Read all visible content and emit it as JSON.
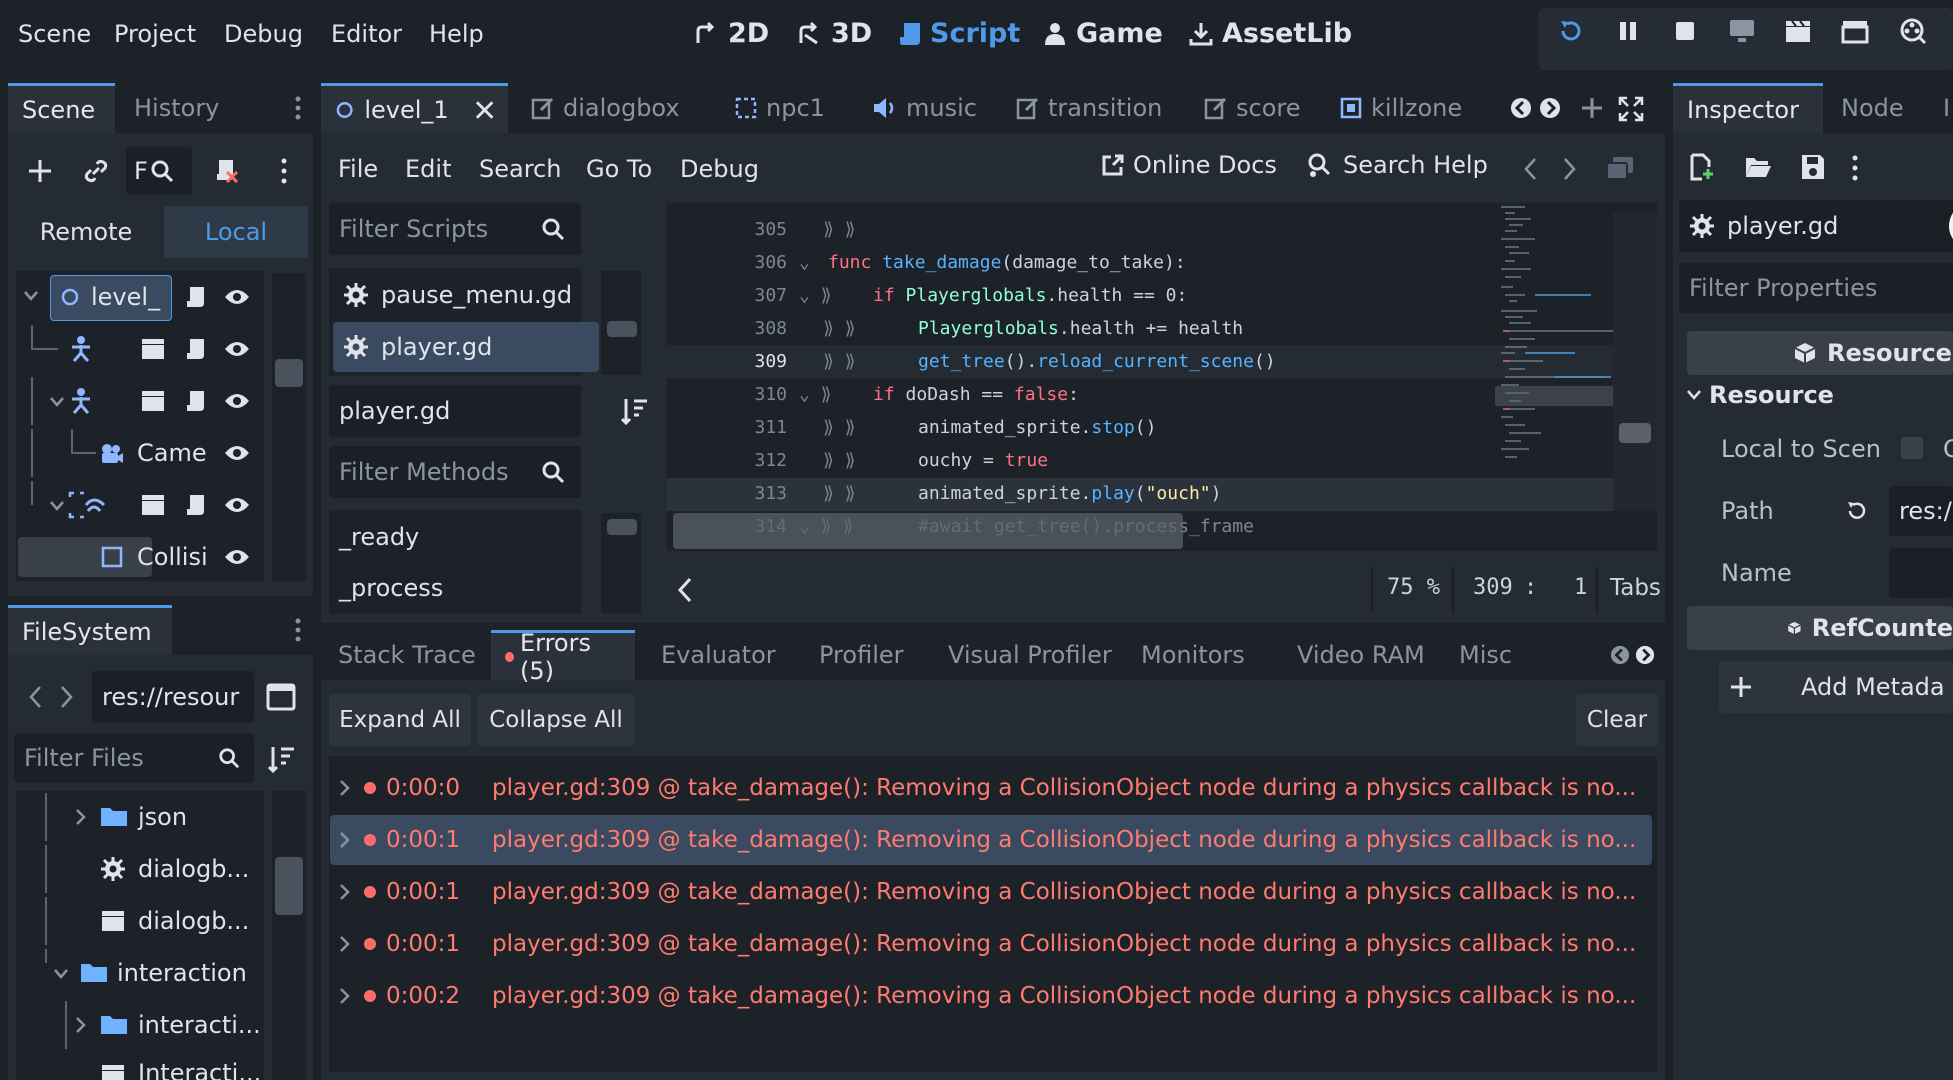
{
  "menu": [
    "Scene",
    "Project",
    "Debug",
    "Editor",
    "Help"
  ],
  "workspaces": [
    {
      "label": "2D",
      "icon": "2d-icon"
    },
    {
      "label": "3D",
      "icon": "3d-icon"
    },
    {
      "label": "Script",
      "icon": "script-icon"
    },
    {
      "label": "Game",
      "icon": "game-icon"
    },
    {
      "label": "AssetLib",
      "icon": "assetlib-icon"
    }
  ],
  "scene_dock": {
    "tabs": [
      "Scene",
      "History"
    ],
    "filter_abbrev": "F",
    "remote_label": "Remote",
    "local_label": "Local",
    "nodes": [
      "level_",
      "Came",
      "Collisi"
    ]
  },
  "filesystem": {
    "tab": "FileSystem",
    "path": "res://resour",
    "filter_placeholder": "Filter Files",
    "items": [
      "json",
      "dialogb...",
      "dialogb...",
      "interaction",
      "interacti...",
      "Interacti..."
    ]
  },
  "script_tabs": [
    "level_1",
    "dialogbox",
    "npc1",
    "music",
    "transition",
    "score",
    "killzone"
  ],
  "script_menu": [
    "File",
    "Edit",
    "Search",
    "Go To",
    "Debug"
  ],
  "online_docs": "Online Docs",
  "search_help": "Search Help",
  "scripts_panel": {
    "filter_placeholder": "Filter Scripts",
    "scripts": [
      "pause_menu.gd",
      "player.gd"
    ],
    "current": "player.gd",
    "methods_placeholder": "Filter Methods",
    "methods": [
      "_ready",
      "_process"
    ]
  },
  "code": {
    "line_numbers": [
      "305",
      "306",
      "307",
      "308",
      "309",
      "310",
      "311",
      "312",
      "313",
      "314"
    ],
    "l306": {
      "kw": "func",
      "name": "take_damage",
      "args": "(damage_to_take):"
    },
    "l307": {
      "kw": "if",
      "obj": "Playerglobals",
      "rest": ".health == 0:"
    },
    "l308": {
      "obj": "Playerglobals",
      "rest": ".health += health"
    },
    "l309": {
      "fn1": "get_tree",
      "mid": "().",
      "fn2": "reload_current_scene",
      "end": "()"
    },
    "l310": {
      "kw": "if",
      "rest": " doDash == ",
      "kw2": "false",
      "end": ":"
    },
    "l311": {
      "obj": "animated_sprite.",
      "fn": "stop",
      "end": "()"
    },
    "l312": {
      "obj": "ouchy = ",
      "kw": "true"
    },
    "l313": {
      "obj": "animated_sprite.",
      "fn": "play",
      "open": "(",
      "str": "\"ouch\"",
      "end": ")"
    },
    "l314": "#await get_tree().process_frame",
    "zoom": "75 %",
    "line": "309",
    "sep": ":",
    "col": "1",
    "indent": "Tabs"
  },
  "bottom_tabs": [
    "Stack Trace",
    "Errors (5)",
    "Evaluator",
    "Profiler",
    "Visual Profiler",
    "Monitors",
    "Video RAM",
    "Misc"
  ],
  "errors_panel": {
    "expand_all": "Expand All",
    "collapse_all": "Collapse All",
    "clear": "Clear",
    "rows": [
      {
        "time": "0:00:0",
        "msg": "player.gd:309 @ take_damage(): Removing a CollisionObject node during a physics callback is no..."
      },
      {
        "time": "0:00:1",
        "msg": "player.gd:309 @ take_damage(): Removing a CollisionObject node during a physics callback is no..."
      },
      {
        "time": "0:00:1",
        "msg": "player.gd:309 @ take_damage(): Removing a CollisionObject node during a physics callback is no..."
      },
      {
        "time": "0:00:1",
        "msg": "player.gd:309 @ take_damage(): Removing a CollisionObject node during a physics callback is no..."
      },
      {
        "time": "0:00:2",
        "msg": "player.gd:309 @ take_damage(): Removing a CollisionObject node during a physics callback is no..."
      }
    ]
  },
  "inspector": {
    "tabs": [
      "Inspector",
      "Node"
    ],
    "third_tab_fragment": "I",
    "object": "player.gd",
    "filter_placeholder": "Filter Properties",
    "resource_header": "Resource",
    "resource_section": "Resource",
    "local_to_scene": "Local to Scen",
    "local_value_fragment": "O",
    "path_label": "Path",
    "path_value": "res:/",
    "name_label": "Name",
    "refcounted_header": "RefCounte",
    "add_metadata": "Add Metada"
  },
  "colors": {
    "accent": "#4e9ae8",
    "error": "#ff7a6f",
    "background": "#1d2229",
    "panel": "#252b33"
  }
}
